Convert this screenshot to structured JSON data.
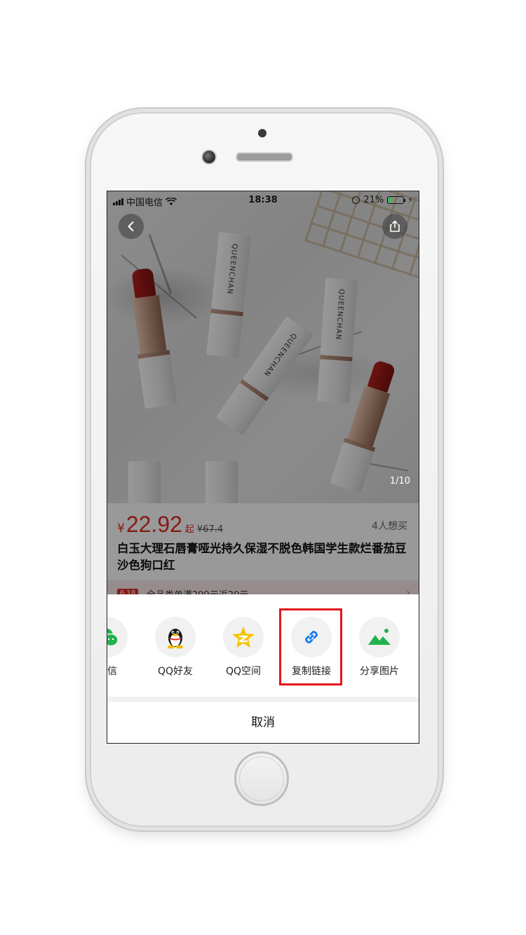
{
  "status_bar": {
    "carrier": "中国电信",
    "time": "18:38",
    "battery": "21%",
    "battery_level": 0.21
  },
  "hero": {
    "page_counter": "1/10",
    "brand_text": "QUEENCHAN"
  },
  "product": {
    "currency": "¥",
    "price": "22.92",
    "price_suffix": "起",
    "original_price": "¥67.4",
    "wants": "4人想买",
    "title": "白玉大理石唇膏哑光持久保湿不脱色韩国学生款烂番茄豆沙色狗口红",
    "promo_tag": "6.18",
    "promo_text": "全品类单满299元返20元"
  },
  "share_sheet": {
    "items": [
      {
        "label": "微信",
        "icon": "wechat-icon"
      },
      {
        "label": "QQ好友",
        "icon": "qq-icon"
      },
      {
        "label": "QQ空间",
        "icon": "qzone-icon"
      },
      {
        "label": "复制链接",
        "icon": "link-icon"
      },
      {
        "label": "分享图片",
        "icon": "image-icon"
      }
    ],
    "cancel": "取消",
    "highlight_color": "#e3161b"
  },
  "colors": {
    "price_red": "#e02e24",
    "link_blue": "#1a7cf0",
    "green": "#22b14c"
  }
}
